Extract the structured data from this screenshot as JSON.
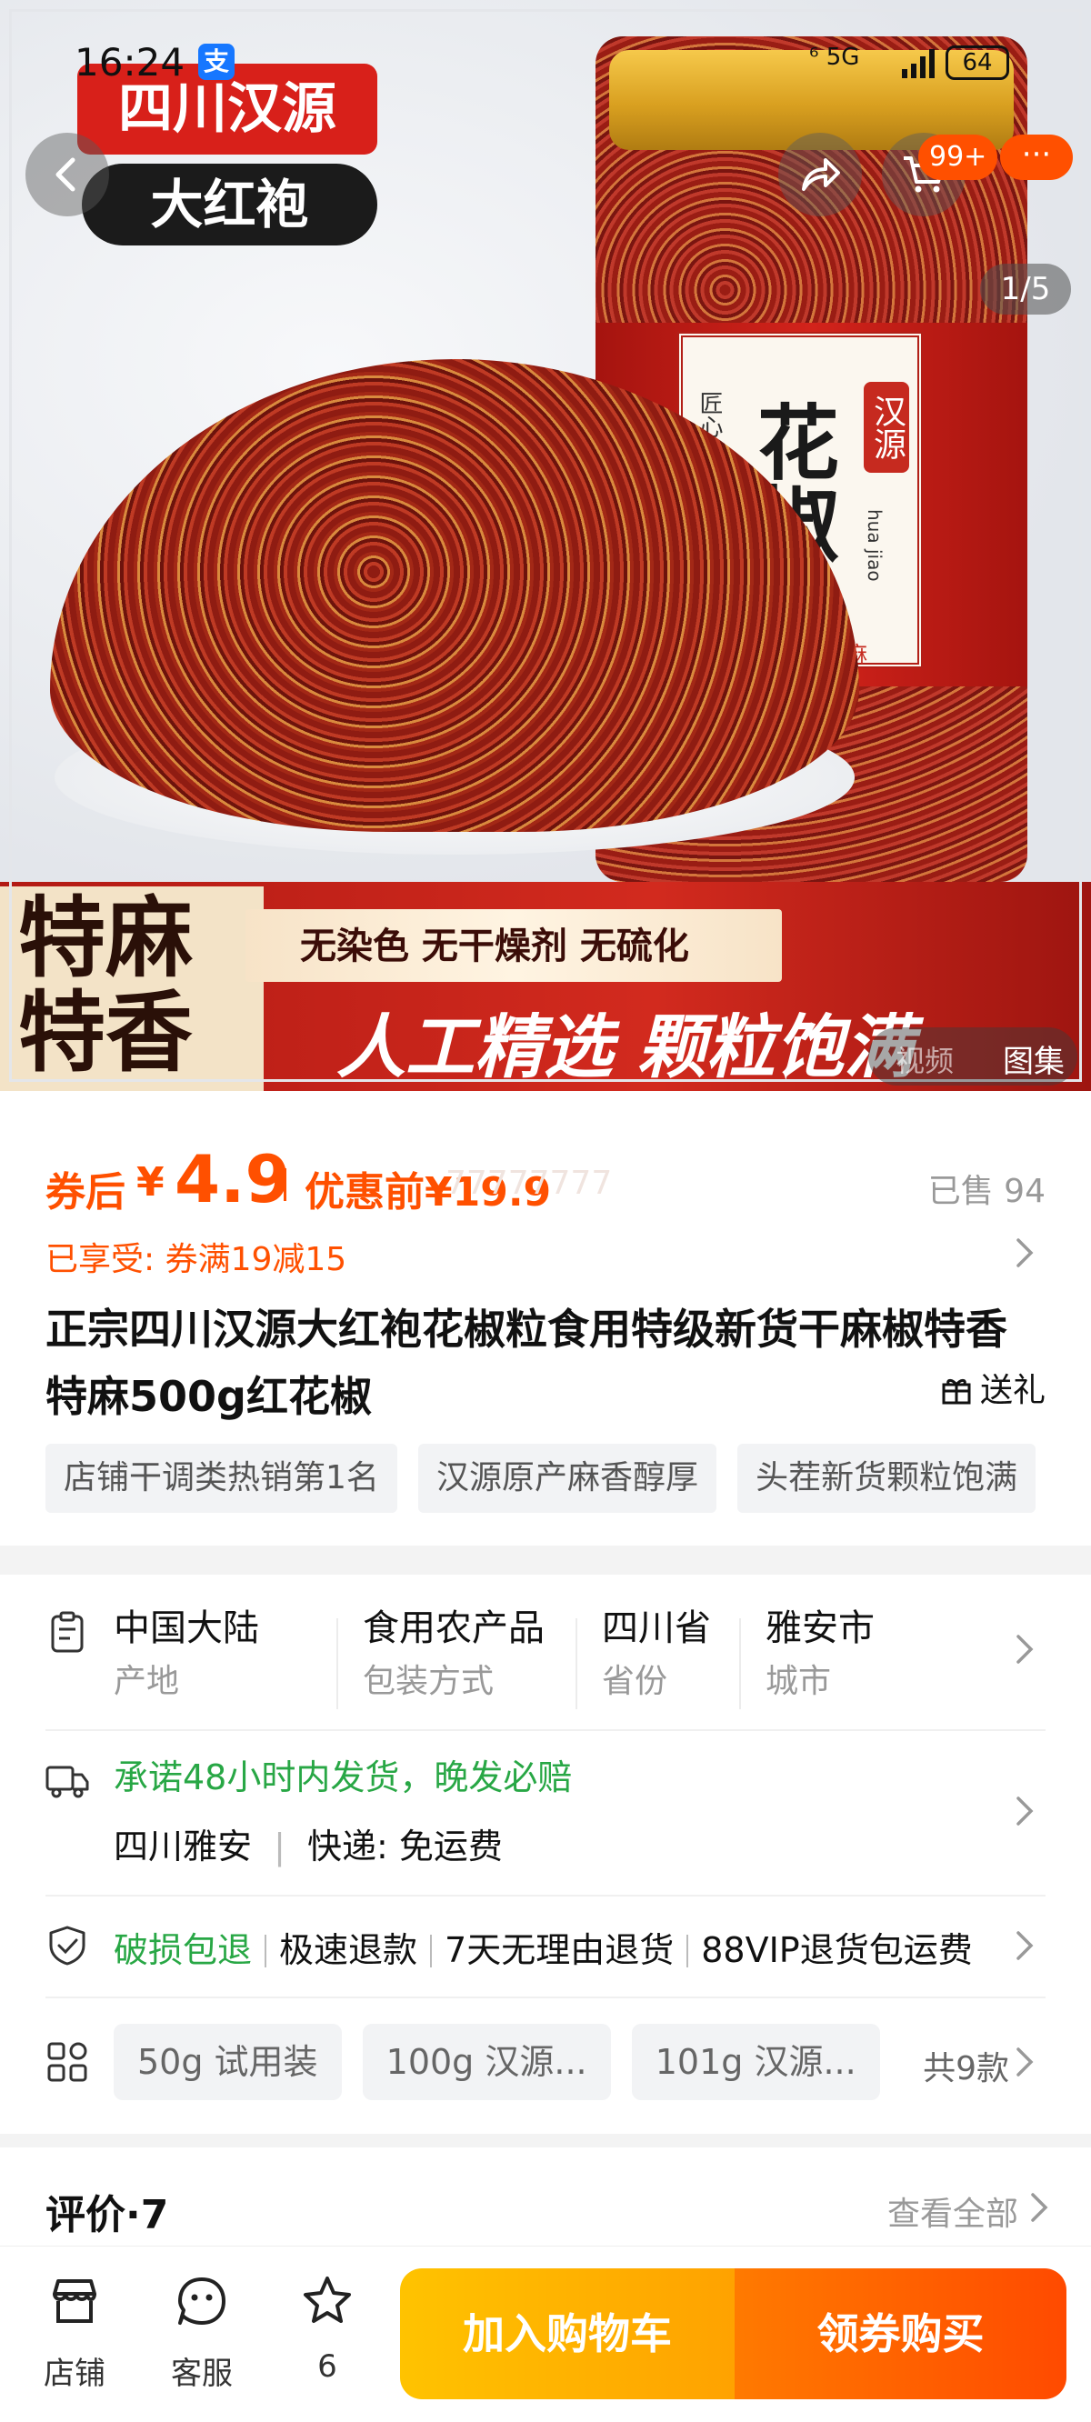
{
  "status_bar": {
    "time": "16:24",
    "alipay_badge": "支",
    "network": "⁶ 5G",
    "battery": "64"
  },
  "hero": {
    "badge_top": "四川汉源",
    "badge_bottom": "大红袍",
    "jar_label_big": "花椒",
    "jar_label_seal": "汉源",
    "jar_label_side": "匠心好品质",
    "jar_label_pinyin": "hua jiao",
    "jar_label_foot": "麻",
    "strip_left": "特麻特香",
    "strip_tags": "无染色  无干燥剂  无硫化",
    "strip_big": "人工精选 颗粒饱满",
    "counter": "1/5",
    "cart_badge": "99+",
    "video_label": "视频",
    "gallery_label": "图集"
  },
  "price": {
    "after_label": "券后",
    "currency": "¥",
    "after_value": "4.9",
    "before_label": "优惠前¥19.9",
    "faint_text": "77777777",
    "sold": "已售 94"
  },
  "promo": {
    "enjoyed": "已享受: 券满19减15"
  },
  "product": {
    "title": "正宗四川汉源大红袍花椒粒食用特级新货干麻椒特香特麻500g红花椒",
    "gift_label": "送礼",
    "tags": [
      "店铺干调类热销第1名",
      "汉源原产麻香醇厚",
      "头茬新货颗粒饱满"
    ]
  },
  "attributes": [
    {
      "value": "中国大陆",
      "key": "产地"
    },
    {
      "value": "食用农产品",
      "key": "包装方式"
    },
    {
      "value": "四川省",
      "key": "省份"
    },
    {
      "value": "雅安市",
      "key": "城市"
    }
  ],
  "shipping": {
    "promise": "承诺48小时内发货，晚发必赔",
    "origin": "四川雅安",
    "sep": "|",
    "courier": "快递: 免运费"
  },
  "guarantee": {
    "items": [
      "破损包退",
      "极速退款",
      "7天无理由退货",
      "88VIP退货包运费"
    ]
  },
  "variants": {
    "items": [
      "50g 试用装",
      "100g 汉源...",
      "101g 汉源..."
    ],
    "count": "共9款"
  },
  "reviews": {
    "title": "评价·7",
    "see_all": "查看全部"
  },
  "bottom_bar": {
    "shop": "店铺",
    "service": "客服",
    "favorites": "6",
    "add_cart": "加入购物车",
    "buy": "领券购买"
  },
  "colors": {
    "accent": "#ff5000",
    "green": "#28a745",
    "cart_yellow": "#ffb300",
    "buy_orange": "#ff5a00"
  }
}
